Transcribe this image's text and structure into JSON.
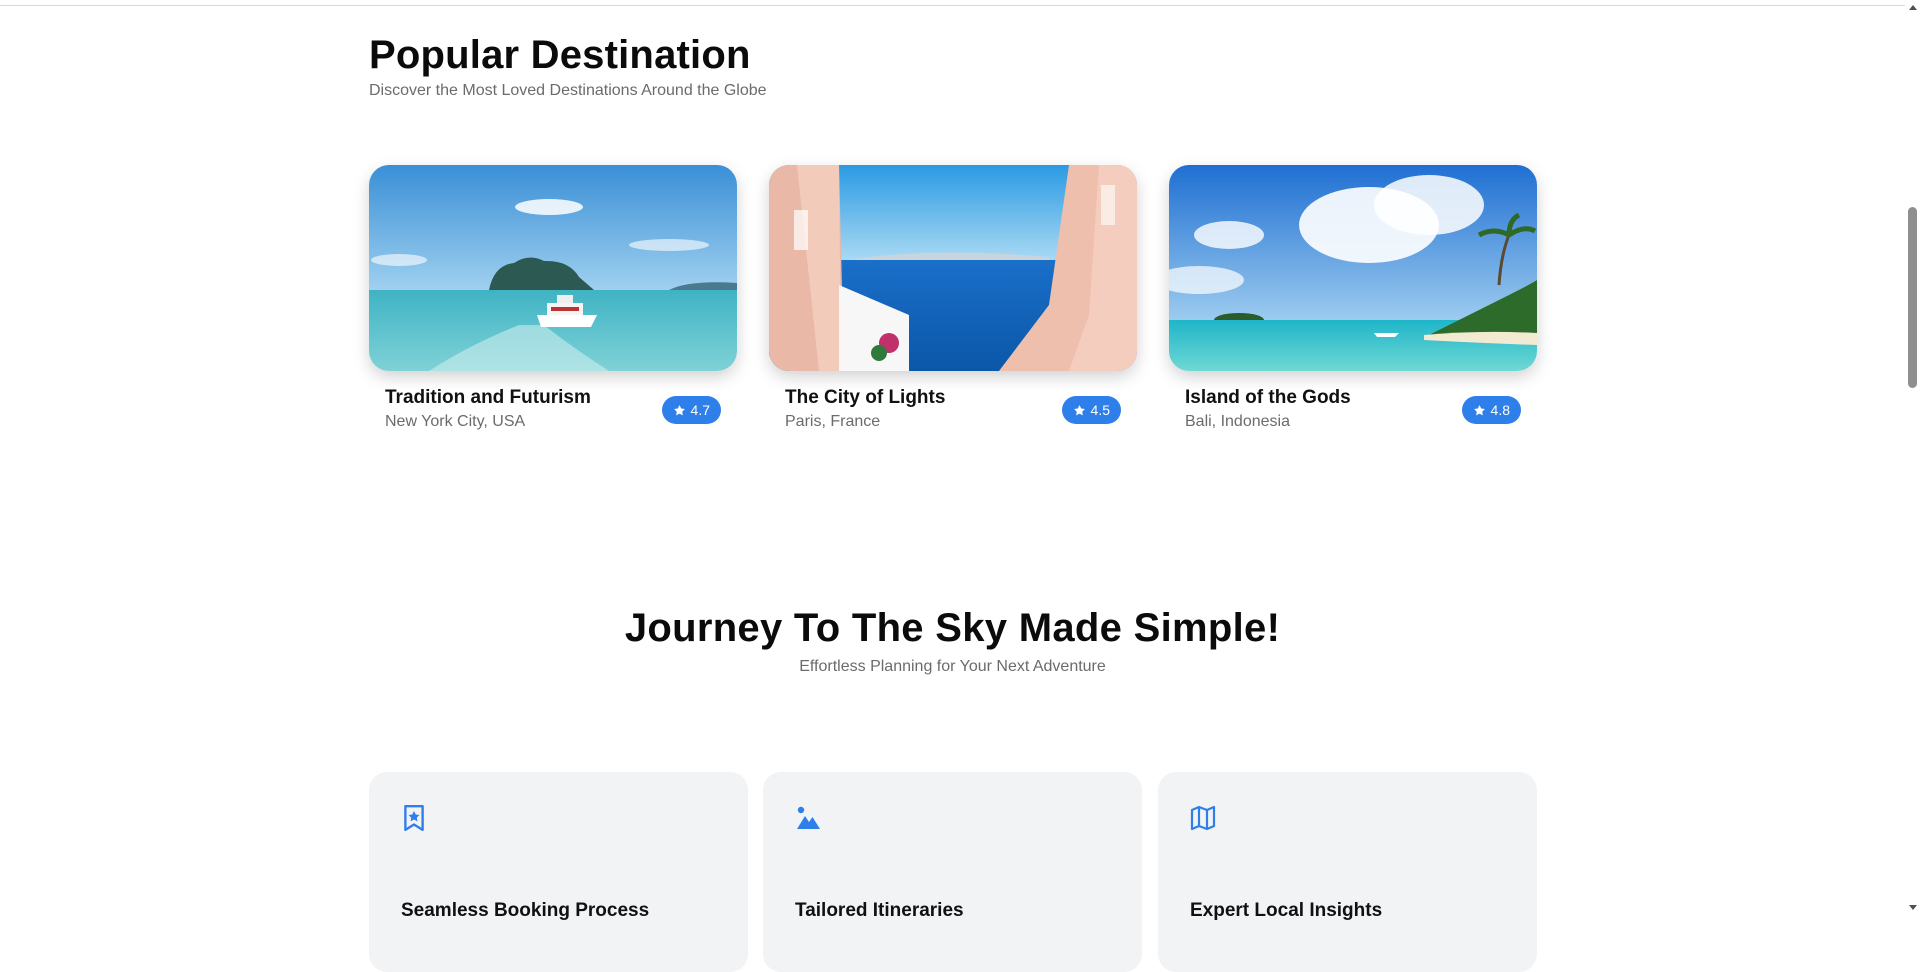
{
  "popular": {
    "title": "Popular Destination",
    "subtitle": "Discover the Most Loved Destinations Around the Globe",
    "cards": [
      {
        "title": "Tradition and Futurism",
        "location": "New York City, USA",
        "rating": "4.7",
        "image": "boat-island-sea"
      },
      {
        "title": "The City of Lights",
        "location": "Paris, France",
        "rating": "4.5",
        "image": "santorini-sea-view"
      },
      {
        "title": "Island of the Gods",
        "location": "Bali, Indonesia",
        "rating": "4.8",
        "image": "tropical-beach-palms"
      }
    ]
  },
  "journey": {
    "title": "Journey To The Sky Made Simple!",
    "subtitle": "Effortless Planning for Your Next Adventure",
    "features": [
      {
        "title": "Seamless Booking Process",
        "icon": "bookmark-star-icon"
      },
      {
        "title": "Tailored Itineraries",
        "icon": "mountain-icon"
      },
      {
        "title": "Expert Local Insights",
        "icon": "map-icon"
      }
    ]
  },
  "colors": {
    "accent": "#2f7fea",
    "card_bg": "#f2f3f5",
    "muted_text": "#6b6b6b"
  }
}
